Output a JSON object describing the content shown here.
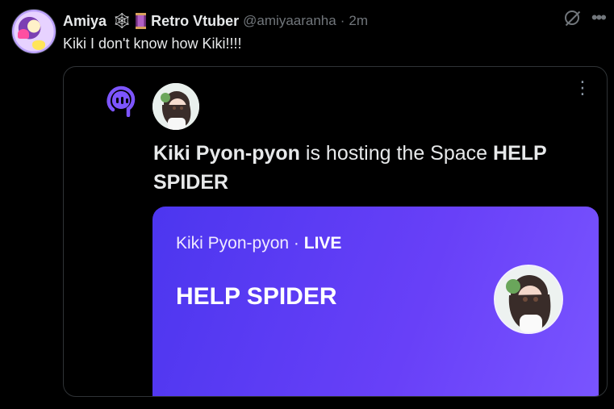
{
  "tweet": {
    "author_name": "Amiya",
    "emoji_web": "🕸",
    "badge_text": "Retro Vtuber",
    "handle": "@amiyaaranha",
    "separator": "·",
    "time": "2m",
    "text": "Kiki I don't know how Kiki!!!!"
  },
  "space": {
    "host_name": "Kiki Pyon-pyon",
    "host_phrase": "is hosting the Space",
    "title_line": "HELP SPIDER",
    "live_host": "Kiki Pyon-pyon",
    "live_dot": "·",
    "live_label": "LIVE",
    "panel_title": "HELP SPIDER"
  },
  "icons": {
    "grok": "grok-icon",
    "more": "more-horizontal-icon",
    "space_mic": "spaces-microphone-icon",
    "kebab": "more-vertical-icon"
  },
  "colors": {
    "background": "#000000",
    "text": "#e7e9ea",
    "secondary": "#71767b",
    "space_accent": "#7856ff"
  }
}
